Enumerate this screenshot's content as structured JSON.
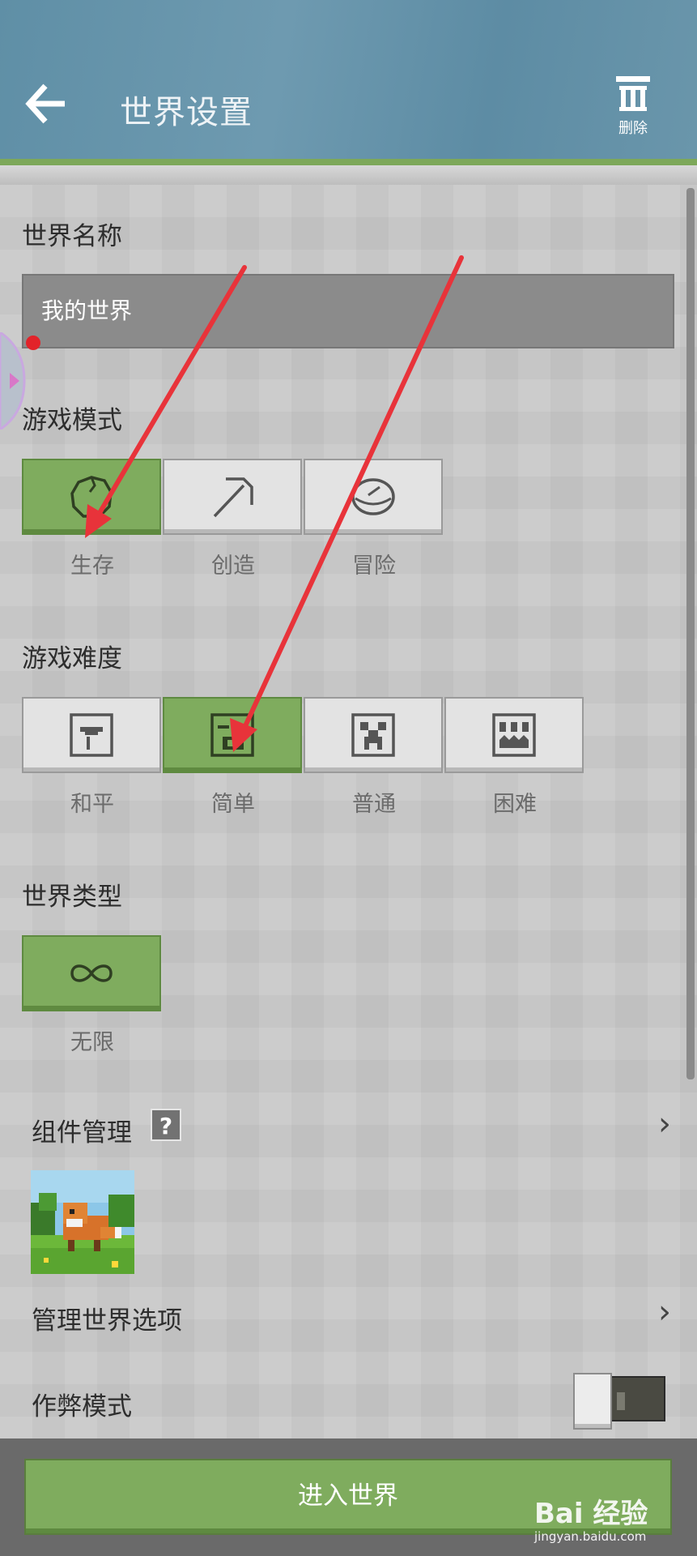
{
  "header": {
    "title": "世界设置",
    "delete_label": "删除"
  },
  "world_name": {
    "label": "世界名称",
    "value": "我的世界"
  },
  "game_mode": {
    "label": "游戏模式",
    "options": [
      {
        "label": "生存",
        "icon": "apple-icon",
        "selected": true
      },
      {
        "label": "创造",
        "icon": "pickaxe-icon",
        "selected": false
      },
      {
        "label": "冒险",
        "icon": "compass-icon",
        "selected": false
      }
    ]
  },
  "difficulty": {
    "label": "游戏难度",
    "options": [
      {
        "label": "和平",
        "icon": "peaceful-icon",
        "selected": false
      },
      {
        "label": "简单",
        "icon": "easy-icon",
        "selected": true
      },
      {
        "label": "普通",
        "icon": "creeper-icon",
        "selected": false
      },
      {
        "label": "困难",
        "icon": "hard-icon",
        "selected": false
      }
    ]
  },
  "world_type": {
    "label": "世界类型",
    "options": [
      {
        "label": "无限",
        "icon": "infinity-icon",
        "selected": true
      }
    ]
  },
  "addons": {
    "label": "组件管理",
    "help": "?"
  },
  "world_options": {
    "label": "管理世界选项"
  },
  "cheats": {
    "label": "作弊模式",
    "enabled": false
  },
  "footer": {
    "enter_label": "进入世界"
  },
  "watermark": {
    "brand": "Bai 经验",
    "url": "jingyan.baidu.com"
  },
  "colors": {
    "accent_green": "#7fac5e",
    "header_blue": "#6592aa",
    "annotation_red": "#e8333a"
  }
}
